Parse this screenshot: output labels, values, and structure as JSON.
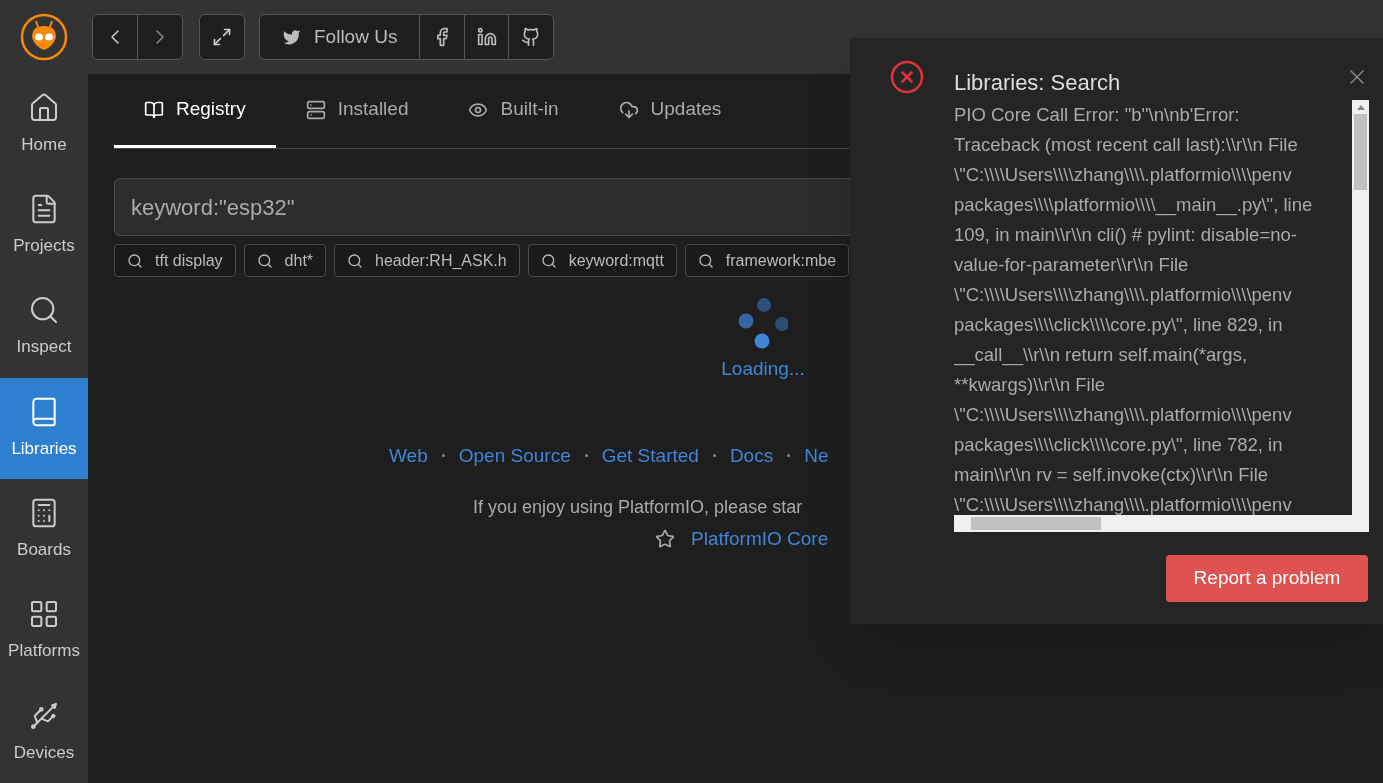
{
  "toolbar": {
    "follow_label": "Follow Us"
  },
  "sidebar": {
    "items": [
      {
        "label": "Home",
        "kind": "home",
        "selected": false
      },
      {
        "label": "Projects",
        "kind": "projects",
        "selected": false
      },
      {
        "label": "Inspect",
        "kind": "inspect",
        "selected": false
      },
      {
        "label": "Libraries",
        "kind": "libraries",
        "selected": true
      },
      {
        "label": "Boards",
        "kind": "boards",
        "selected": false
      },
      {
        "label": "Platforms",
        "kind": "platforms",
        "selected": false
      },
      {
        "label": "Devices",
        "kind": "devices",
        "selected": false
      }
    ]
  },
  "tabs": [
    {
      "label": "Registry",
      "kind": "registry",
      "selected": true
    },
    {
      "label": "Installed",
      "kind": "installed",
      "selected": false
    },
    {
      "label": "Built-in",
      "kind": "builtin",
      "selected": false
    },
    {
      "label": "Updates",
      "kind": "updates",
      "selected": false
    }
  ],
  "search": {
    "value": "keyword:\"esp32\""
  },
  "suggestions": [
    "tft display",
    "dht*",
    "header:RH_ASK.h",
    "keyword:mqtt",
    "framework:mbe"
  ],
  "loading": "Loading...",
  "links": [
    "Web",
    "Open Source",
    "Get Started",
    "Docs",
    "Ne"
  ],
  "star_text": "If you enjoy using PlatformIO, please star",
  "star_link": "PlatformIO Core",
  "dialog": {
    "title": "Libraries: Search",
    "lines": [
      "PIO Core Call Error: \"b''\\n\\nb'Error:",
      "Traceback (most recent call last):\\\\r\\\\n File",
      "\\\"C:\\\\\\\\Users\\\\\\\\zhang\\\\\\\\.platformio\\\\\\\\penv",
      "packages\\\\\\\\platformio\\\\\\\\__main__.py\\\", line",
      "109, in main\\\\r\\\\n cli() # pylint: disable=no-",
      "value-for-parameter\\\\r\\\\n File",
      "\\\"C:\\\\\\\\Users\\\\\\\\zhang\\\\\\\\.platformio\\\\\\\\penv",
      "packages\\\\\\\\click\\\\\\\\core.py\\\", line 829, in",
      "__call__\\\\r\\\\n return self.main(*args,",
      "**kwargs)\\\\r\\\\n File",
      "\\\"C:\\\\\\\\Users\\\\\\\\zhang\\\\\\\\.platformio\\\\\\\\penv",
      "packages\\\\\\\\click\\\\\\\\core.py\\\", line 782, in",
      "main\\\\r\\\\n rv = self.invoke(ctx)\\\\r\\\\n File",
      "\\\"C:\\\\\\\\Users\\\\\\\\zhang\\\\\\\\.platformio\\\\\\\\penv"
    ],
    "button": "Report a problem"
  }
}
